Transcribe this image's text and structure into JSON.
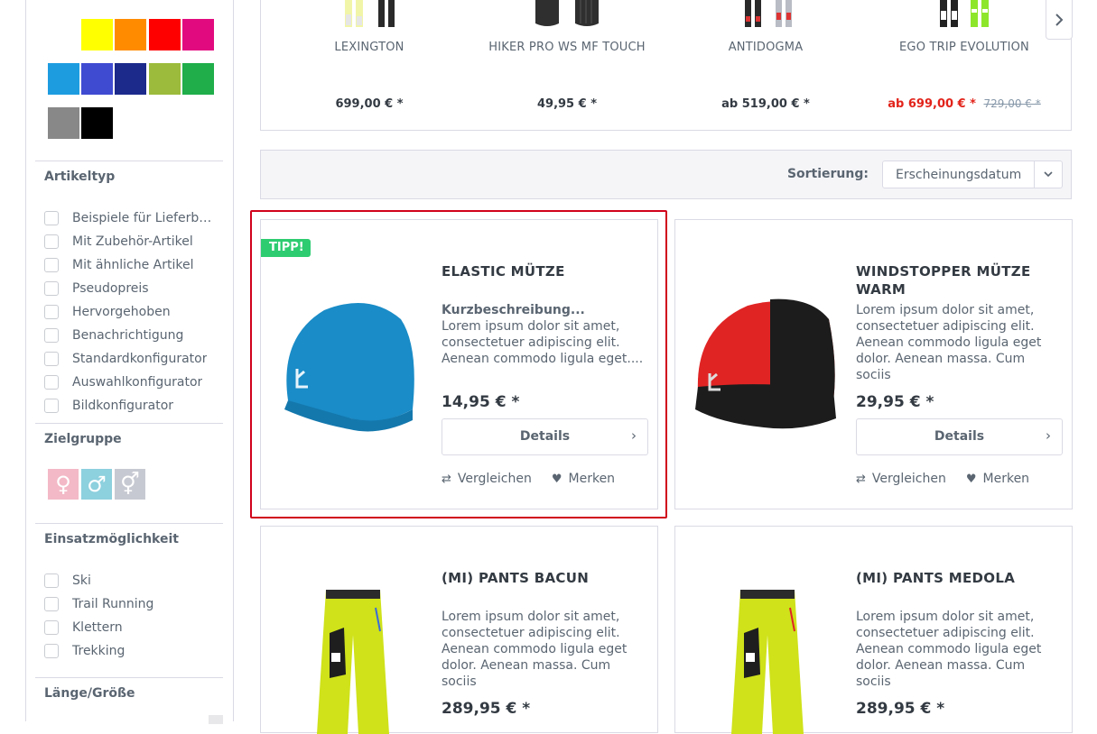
{
  "colors": {
    "swatches": [
      "#ffff00",
      "#ff8c00",
      "#ff0000",
      "#e20a7f",
      "#1d9ce0",
      "#3f4bd1",
      "#1c2a8c",
      "#9cbb3c",
      "#1fae4a",
      "#888888",
      "#000000"
    ],
    "accent_red": "#e2231a",
    "badge_green": "#2ecc71",
    "highlight_red": "#d0021b"
  },
  "filters": {
    "article_type": {
      "heading": "Artikeltyp",
      "items": [
        "Beispiele für Lieferbar...",
        "Mit Zubehör-Artikel",
        "Mit ähnliche Artikel",
        "Pseudopreis",
        "Hervorgehoben",
        "Benachrichtigung",
        "Standardkonfigurator",
        "Auswahlkonfigurator",
        "Bildkonfigurator"
      ]
    },
    "target_group": {
      "heading": "Zielgruppe",
      "options": [
        {
          "symbol": "♀",
          "color": "#f3b9c6"
        },
        {
          "symbol": "♂",
          "color": "#8dd0de"
        },
        {
          "symbol": "⚥",
          "color": "#c7c9d2"
        }
      ]
    },
    "usage": {
      "heading": "Einsatzmöglichkeit",
      "items": [
        "Ski",
        "Trail Running",
        "Klettern",
        "Trekking"
      ]
    },
    "size": {
      "heading": "Länge/Größe"
    }
  },
  "slider": {
    "items": [
      {
        "name": "LEXINGTON",
        "price": "699,00 € *"
      },
      {
        "name": "HIKER PRO WS MF TOUCH",
        "price": "49,95 € *"
      },
      {
        "name": "ANTIDOGMA",
        "price": "ab 519,00 € *"
      },
      {
        "name": "EGO TRIP EVOLUTION",
        "price_sale": "ab 699,00 € *",
        "price_old": "729,00 € *"
      }
    ],
    "next_icon": "chevron-right-icon"
  },
  "sort": {
    "label": "Sortierung:",
    "selected": "Erscheinungsdatum"
  },
  "products": [
    {
      "badge": "TIPP!",
      "title": "ELASTIC MÜTZE",
      "short_label": "Kurzbeschreibung...",
      "description": "Lorem ipsum dolor sit amet, consectetuer adipiscing elit. Aenean commodo ligula eget....",
      "price": "14,95 € *",
      "details": "Details",
      "compare": "Vergleichen",
      "remember": "Merken"
    },
    {
      "title": "WINDSTOPPER MÜTZE WARM",
      "description": "Lorem ipsum dolor sit amet, consectetuer adipiscing elit. Aenean commodo ligula eget dolor. Aenean massa. Cum sociis",
      "price": "29,95 € *",
      "details": "Details",
      "compare": "Vergleichen",
      "remember": "Merken"
    },
    {
      "title": "(MI) PANTS BACUN",
      "description": "Lorem ipsum dolor sit amet, consectetuer adipiscing elit. Aenean commodo ligula eget dolor. Aenean massa. Cum sociis",
      "price": "289,95 € *"
    },
    {
      "title": "(MI) PANTS MEDOLA",
      "description": "Lorem ipsum dolor sit amet, consectetuer adipiscing elit. Aenean commodo ligula eget dolor. Aenean massa. Cum sociis",
      "price": "289,95 € *"
    }
  ]
}
